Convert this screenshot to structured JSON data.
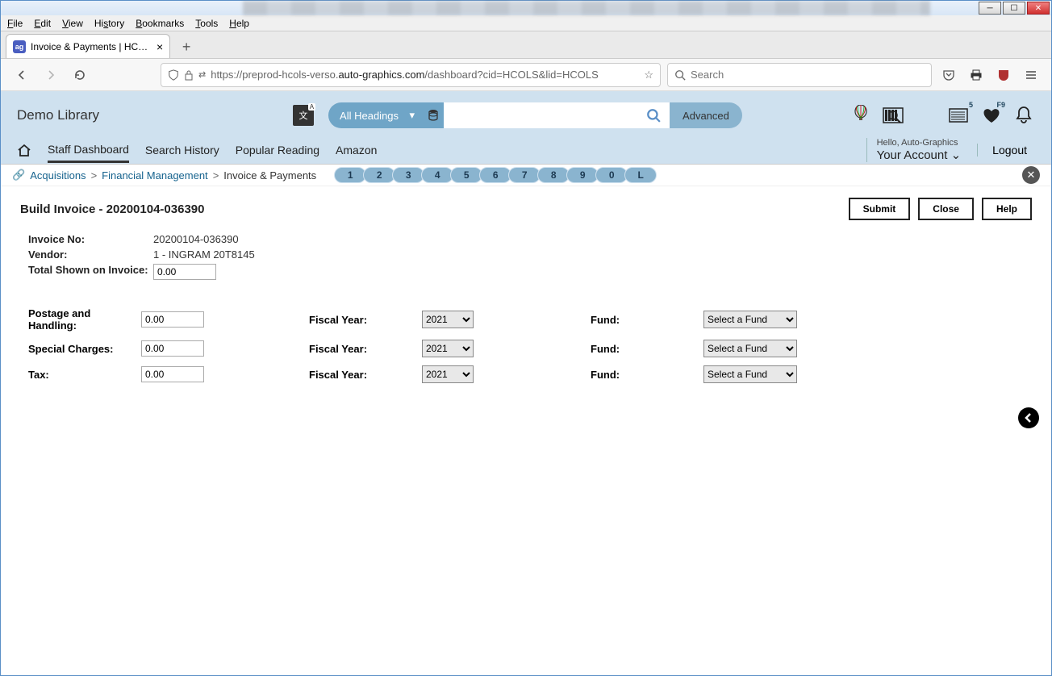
{
  "browser": {
    "menu": [
      "File",
      "Edit",
      "View",
      "History",
      "Bookmarks",
      "Tools",
      "Help"
    ],
    "tab_title": "Invoice & Payments | HCOLS | H",
    "url_prefix": "https://preprod-hcols-verso.",
    "url_domain": "auto-graphics.com",
    "url_suffix": "/dashboard?cid=HCOLS&lid=HCOLS",
    "search_placeholder": "Search"
  },
  "header": {
    "library": "Demo Library",
    "headings_dropdown": "All Headings",
    "advanced": "Advanced",
    "badge_news": "5",
    "badge_heart": "F9",
    "hello": "Hello, Auto-Graphics",
    "account": "Your Account",
    "logout": "Logout",
    "nav": [
      "Staff Dashboard",
      "Search History",
      "Popular Reading",
      "Amazon"
    ]
  },
  "breadcrumb": {
    "items": [
      "Acquisitions",
      "Financial Management",
      "Invoice & Payments"
    ],
    "pages": [
      "1",
      "2",
      "3",
      "4",
      "5",
      "6",
      "7",
      "8",
      "9",
      "0",
      "L"
    ]
  },
  "page": {
    "title": "Build Invoice - 20200104-036390",
    "buttons": {
      "submit": "Submit",
      "close": "Close",
      "help": "Help"
    }
  },
  "invoice": {
    "labels": {
      "invoice_no": "Invoice No:",
      "vendor": "Vendor:",
      "total_shown": "Total Shown on Invoice:"
    },
    "invoice_no": "20200104-036390",
    "vendor": "1 - INGRAM 20T8145",
    "total_shown": "0.00"
  },
  "charges": {
    "rows": [
      {
        "label": "Postage and Handling:",
        "amount": "0.00",
        "fy": "2021",
        "fund": "Select a Fund"
      },
      {
        "label": "Special Charges:",
        "amount": "0.00",
        "fy": "2021",
        "fund": "Select a Fund"
      },
      {
        "label": "Tax:",
        "amount": "0.00",
        "fy": "2021",
        "fund": "Select a Fund"
      }
    ],
    "fy_label": "Fiscal Year:",
    "fund_label": "Fund:"
  }
}
